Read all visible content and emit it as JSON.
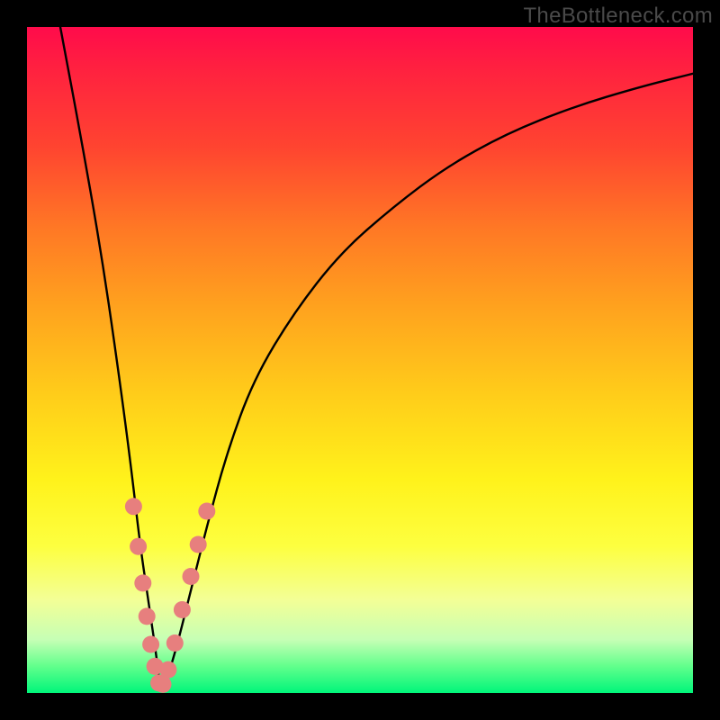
{
  "watermark": "TheBottleneck.com",
  "chart_data": {
    "type": "line",
    "title": "",
    "xlabel": "",
    "ylabel": "",
    "xlim": [
      0,
      100
    ],
    "ylim": [
      0,
      100
    ],
    "series": [
      {
        "name": "bottleneck-curve",
        "x": [
          5,
          8,
          11,
          13.5,
          15.5,
          17,
          18.5,
          19.5,
          20,
          21,
          22.5,
          24.5,
          27,
          30,
          34,
          40,
          47,
          55,
          63,
          72,
          82,
          92,
          100
        ],
        "values": [
          100,
          84,
          67,
          50,
          35,
          22,
          12,
          5,
          0.5,
          2,
          7,
          15,
          25,
          36,
          47,
          57,
          66,
          73,
          79,
          84,
          88,
          91,
          93
        ]
      }
    ],
    "markers": {
      "name": "highlight-dots",
      "color": "#e77f7e",
      "points": [
        {
          "x": 16.0,
          "y": 28
        },
        {
          "x": 16.7,
          "y": 22
        },
        {
          "x": 17.4,
          "y": 16.5
        },
        {
          "x": 18.0,
          "y": 11.5
        },
        {
          "x": 18.6,
          "y": 7.3
        },
        {
          "x": 19.2,
          "y": 4.0
        },
        {
          "x": 19.8,
          "y": 1.5
        },
        {
          "x": 20.4,
          "y": 1.3
        },
        {
          "x": 21.2,
          "y": 3.5
        },
        {
          "x": 22.2,
          "y": 7.5
        },
        {
          "x": 23.3,
          "y": 12.5
        },
        {
          "x": 24.6,
          "y": 17.5
        },
        {
          "x": 25.7,
          "y": 22.3
        },
        {
          "x": 27.0,
          "y": 27.3
        }
      ]
    },
    "background_gradient": {
      "top": "#ff0b4b",
      "mid": "#ffe31b",
      "bottom": "#00f57a"
    }
  }
}
